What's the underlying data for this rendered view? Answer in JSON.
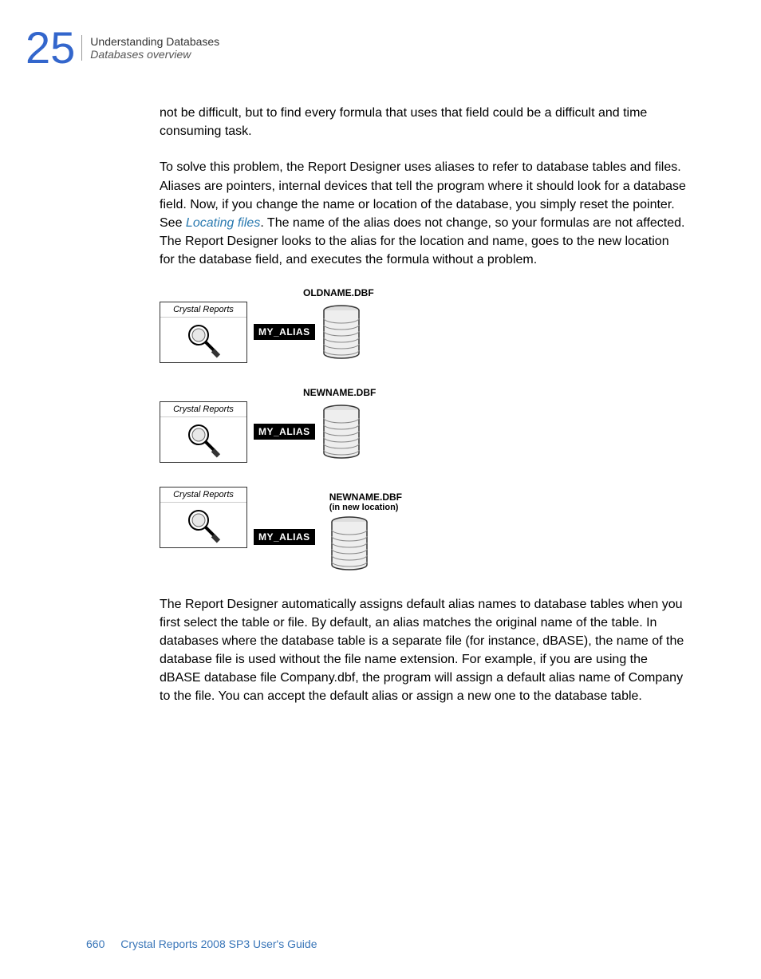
{
  "header": {
    "chapter_number": "25",
    "title": "Understanding Databases",
    "subtitle": "Databases overview"
  },
  "paragraphs": {
    "p1": "not be difficult, but to find every formula that uses that field could be a difficult and time consuming task.",
    "p2a": "To solve this problem, the Report Designer uses aliases to refer to database tables and files. Aliases are pointers, internal devices that tell the program where it should look for a database field. Now, if you change the name or location of the database, you simply reset the pointer. See ",
    "p2_link": "Locating files",
    "p2b": ". The name of the alias does not change, so your formulas are not affected. The Report Designer looks to the alias for the location and name, goes to the new location for the database field, and executes the formula without a problem.",
    "p3": "The Report Designer automatically assigns default alias names to database tables when you first select the table or file. By default, an alias matches the original name of the table. In databases where the database table is a separate file (for instance, dBASE), the name of the database file is used without the file name extension. For example, if you are using the dBASE database file Company.dbf, the program will assign a default alias name of Company to the file. You can accept the default alias or assign a new one to the database table."
  },
  "figures": {
    "cr_label": "Crystal Reports",
    "alias_label": "MY_ALIAS",
    "f1_dbname": "OLDNAME.DBF",
    "f2_dbname": "NEWNAME.DBF",
    "f3_dbname": "NEWNAME.DBF",
    "f3_sub": "(in new location)"
  },
  "footer": {
    "page": "660",
    "text": "Crystal Reports 2008 SP3 User's Guide"
  }
}
